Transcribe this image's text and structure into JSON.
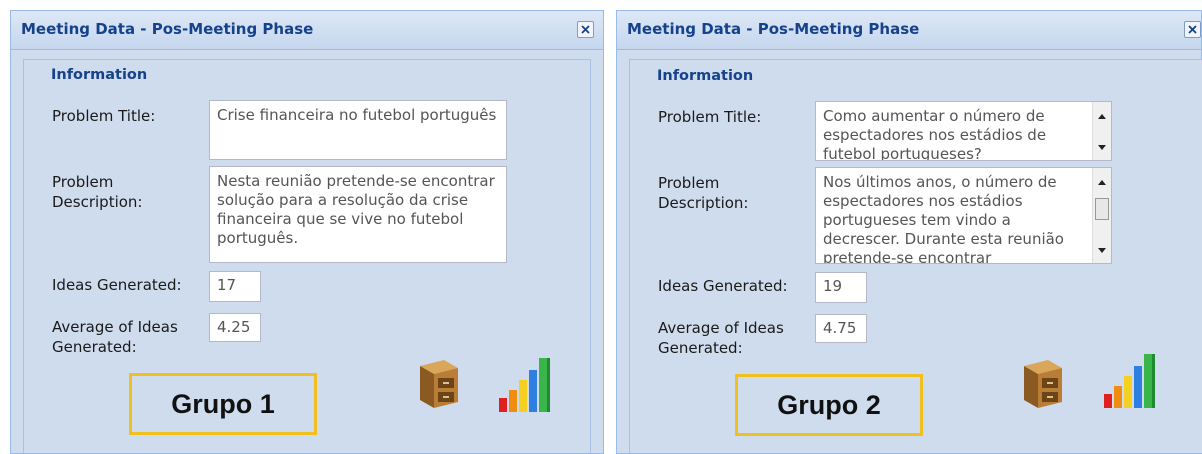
{
  "panels": [
    {
      "title": "Meeting Data - Pos-Meeting Phase",
      "section": "Information",
      "problem_title_label": "Problem Title:",
      "problem_title_value": "Crise financeira no futebol português",
      "problem_description_label_1": "Problem",
      "problem_description_label_2": "Description:",
      "problem_description_value": "Nesta reunião pretende-se encontrar solução para a resolução da crise financeira que se vive no futebol português.",
      "ideas_generated_label": "Ideas Generated:",
      "ideas_generated_value": "17",
      "average_label_1": "Average of Ideas",
      "average_label_2": "Generated:",
      "average_value": "4.25",
      "group_label": "Grupo 1"
    },
    {
      "title": "Meeting Data - Pos-Meeting Phase",
      "section": "Information",
      "problem_title_label": "Problem Title:",
      "problem_title_value": "Como aumentar o número de espectadores nos estádios de futebol portugueses?",
      "problem_description_label_1": "Problem",
      "problem_description_label_2": "Description:",
      "problem_description_value": "Nos últimos anos, o número de espectadores nos estádios portugueses tem vindo a decrescer. Durante esta reunião pretende-se encontrar",
      "ideas_generated_label": "Ideas Generated:",
      "ideas_generated_value": "19",
      "average_label_1": "Average of Ideas",
      "average_label_2": "Generated:",
      "average_value": "4.75",
      "group_label": "Grupo 2"
    }
  ],
  "icons": {
    "close": "close-icon",
    "archive": "file-cabinet-icon",
    "chart": "bar-chart-icon"
  },
  "colors": {
    "panel_bg": "#cfdcee",
    "title_text": "#15428b",
    "group_border": "#f0c020"
  }
}
